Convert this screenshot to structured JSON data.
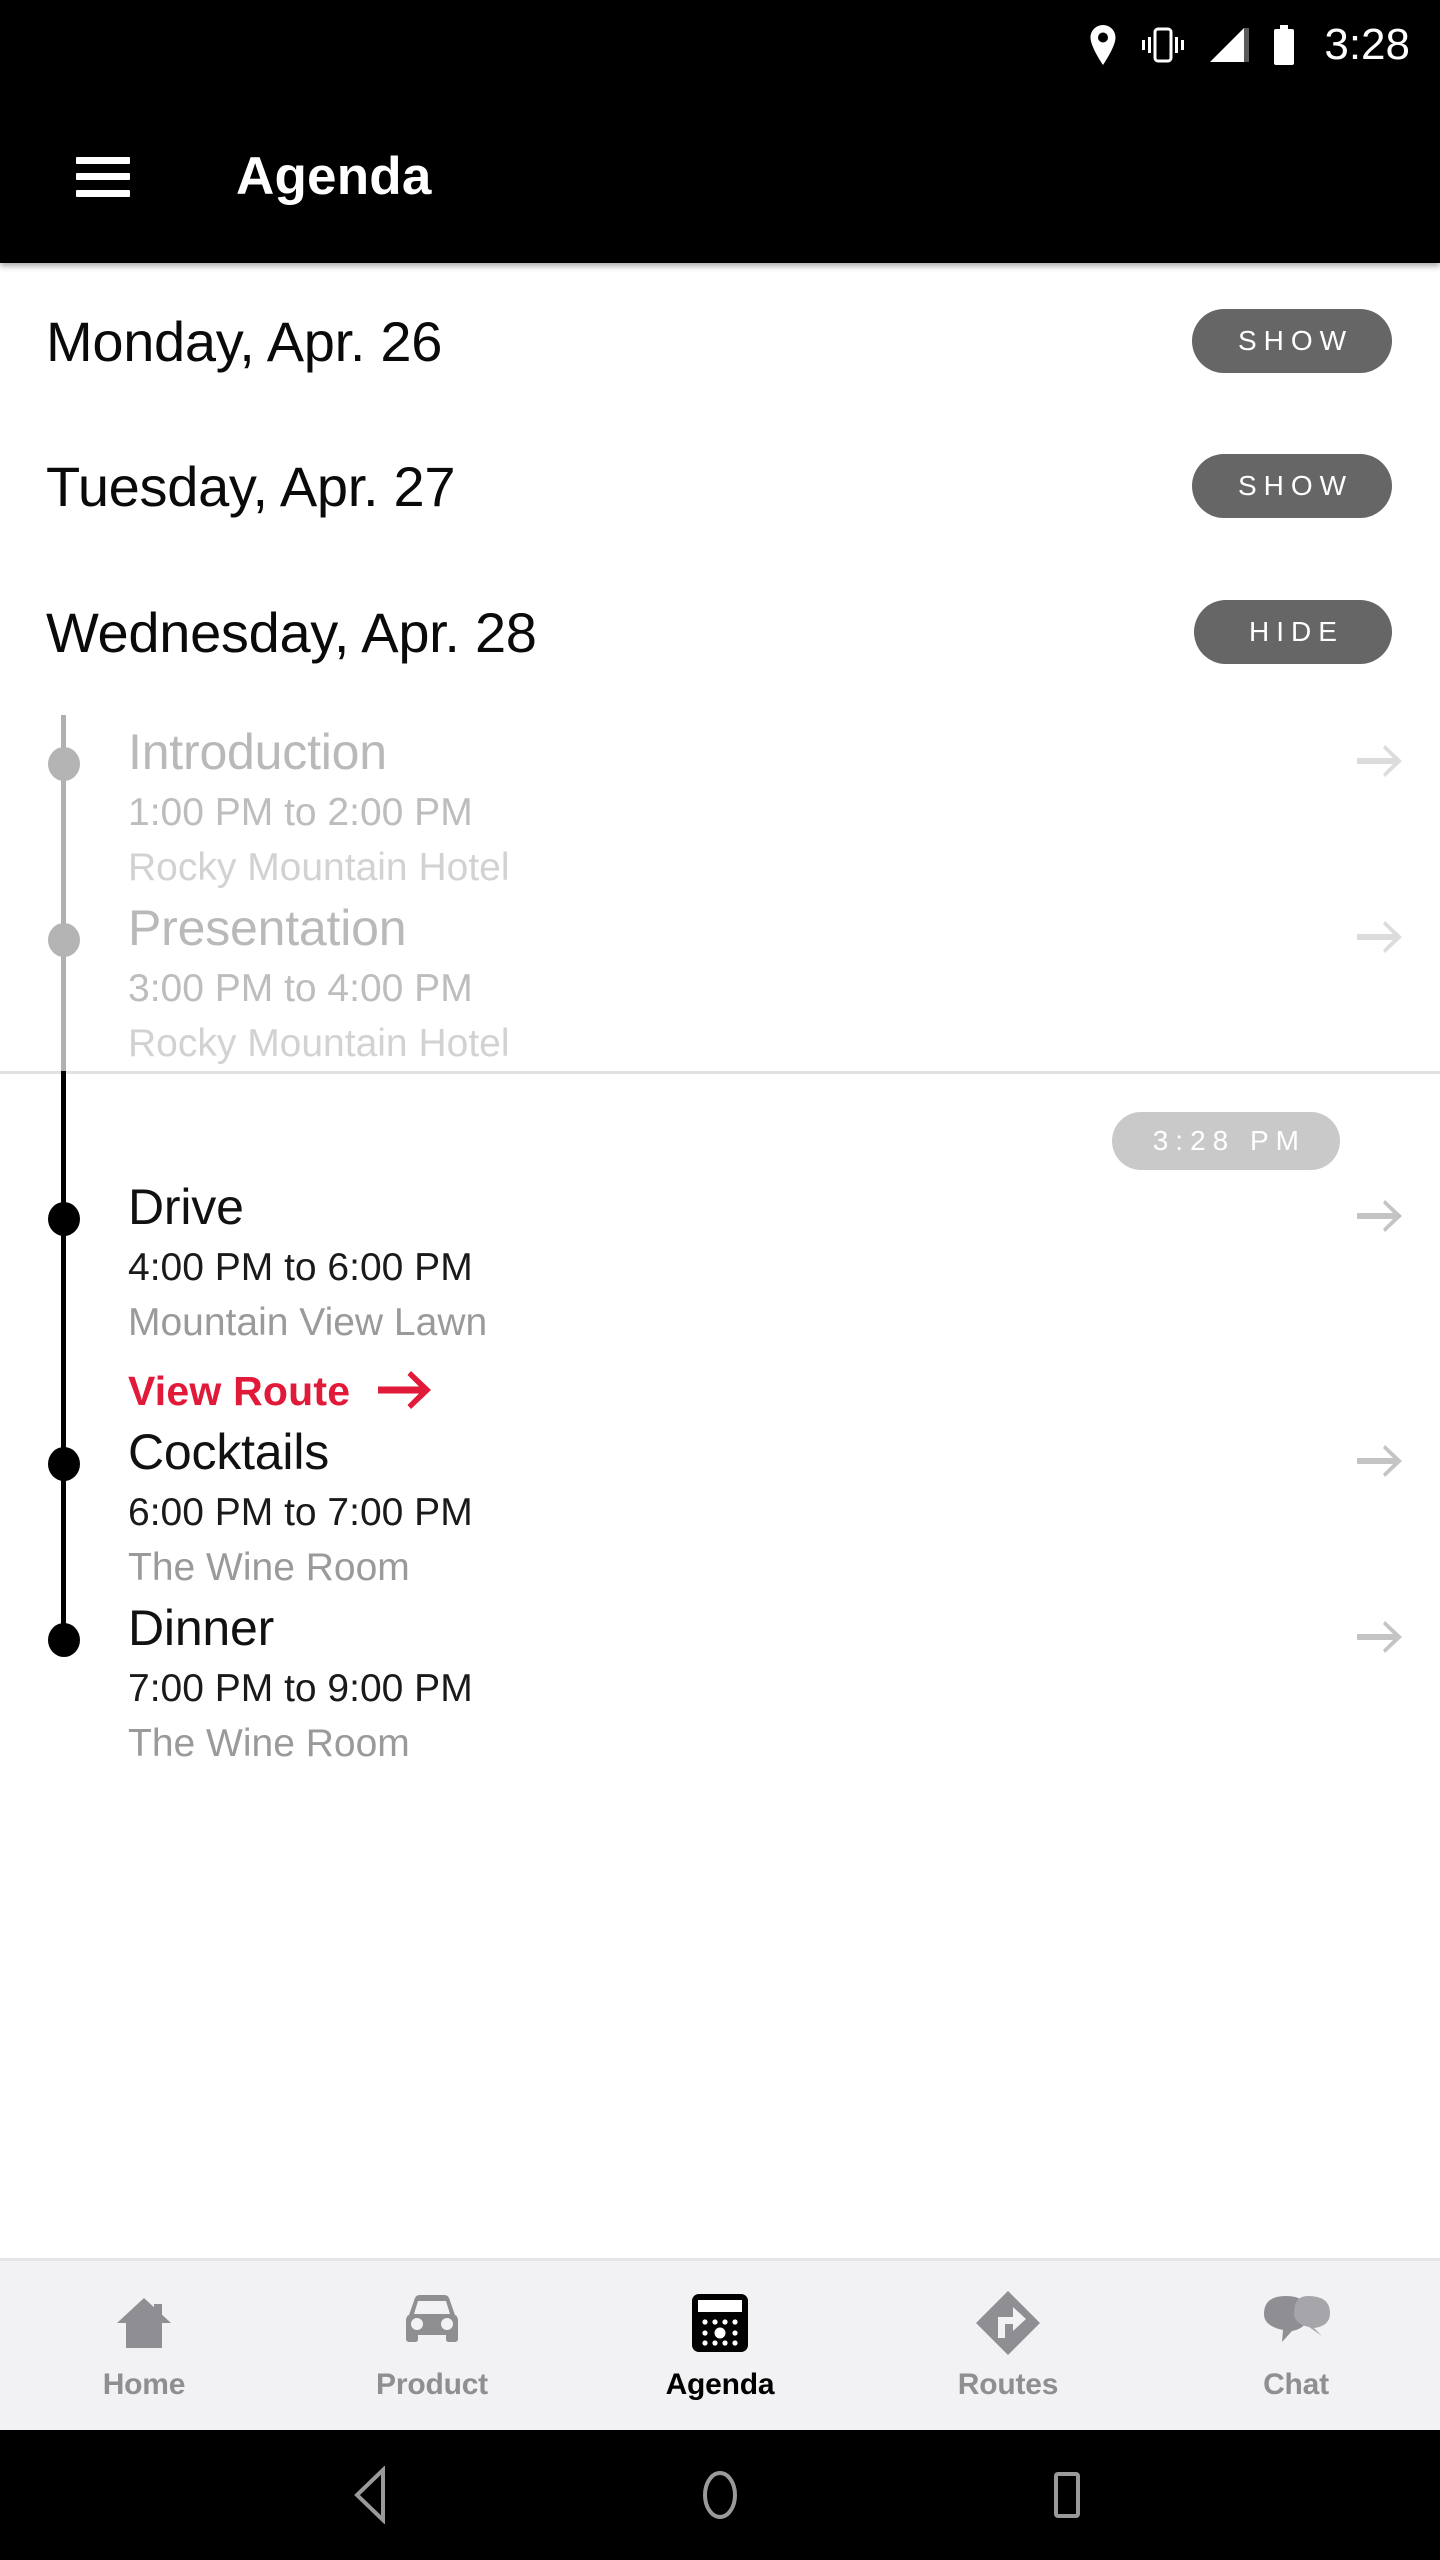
{
  "status_bar": {
    "time": "3:28",
    "icons": [
      "location-pin-icon",
      "vibrate-icon",
      "signal-icon",
      "battery-icon"
    ]
  },
  "app_bar": {
    "menu_icon": "hamburger-menu-icon",
    "title": "Agenda"
  },
  "days": [
    {
      "label": "Monday, Apr. 26",
      "toggle": "SHOW",
      "expanded": false
    },
    {
      "label": "Tuesday, Apr. 27",
      "toggle": "SHOW",
      "expanded": false
    },
    {
      "label": "Wednesday, Apr. 28",
      "toggle": "HIDE",
      "expanded": true
    }
  ],
  "current_time_badge": "3:28 PM",
  "events_past": [
    {
      "title": "Introduction",
      "time": "1:00 PM to 2:00 PM",
      "location": "Rocky Mountain Hotel"
    },
    {
      "title": "Presentation",
      "time": "3:00 PM to 4:00 PM",
      "location": "Rocky Mountain Hotel"
    }
  ],
  "events_upcoming": [
    {
      "title": "Drive",
      "time": "4:00 PM to 6:00 PM",
      "location": "Mountain View Lawn",
      "route_link": "View Route"
    },
    {
      "title": "Cocktails",
      "time": "6:00 PM to 7:00 PM",
      "location": "The Wine Room"
    },
    {
      "title": "Dinner",
      "time": "7:00 PM to 9:00 PM",
      "location": "The Wine Room"
    }
  ],
  "bottom_nav": [
    {
      "label": "Home",
      "icon": "home-icon",
      "active": false
    },
    {
      "label": "Product",
      "icon": "car-icon",
      "active": false
    },
    {
      "label": "Agenda",
      "icon": "calendar-icon",
      "active": true
    },
    {
      "label": "Routes",
      "icon": "route-diamond-icon",
      "active": false
    },
    {
      "label": "Chat",
      "icon": "chat-bubbles-icon",
      "active": false
    }
  ],
  "system_nav": [
    "back-icon",
    "home-circle-icon",
    "recents-square-icon"
  ],
  "colors": {
    "accent_red": "#e01a38",
    "app_bar_bg": "#000000",
    "toggle_pill_bg": "#666666",
    "now_badge_bg": "#c9c9c9",
    "nav_bg": "#f2f1f4",
    "past_text": "#b9b9b9"
  }
}
